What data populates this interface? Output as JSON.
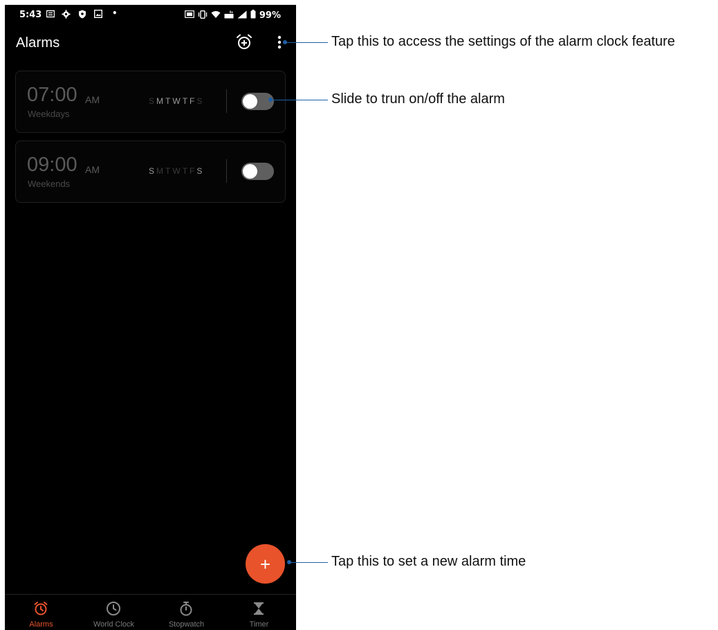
{
  "status_bar": {
    "time": "5:43",
    "battery": "99%"
  },
  "app_bar": {
    "title": "Alarms"
  },
  "alarms": [
    {
      "time": "07:00",
      "ampm": "AM",
      "label": "Weekdays",
      "days": [
        {
          "letter": "S",
          "active": false
        },
        {
          "letter": "M",
          "active": true
        },
        {
          "letter": "T",
          "active": true
        },
        {
          "letter": "W",
          "active": true
        },
        {
          "letter": "T",
          "active": true
        },
        {
          "letter": "F",
          "active": true
        },
        {
          "letter": "S",
          "active": false
        }
      ],
      "enabled": false
    },
    {
      "time": "09:00",
      "ampm": "AM",
      "label": "Weekends",
      "days": [
        {
          "letter": "S",
          "active": true
        },
        {
          "letter": "M",
          "active": false
        },
        {
          "letter": "T",
          "active": false
        },
        {
          "letter": "W",
          "active": false
        },
        {
          "letter": "T",
          "active": false
        },
        {
          "letter": "F",
          "active": false
        },
        {
          "letter": "S",
          "active": true
        }
      ],
      "enabled": false
    }
  ],
  "fab": {
    "icon": "plus-icon",
    "symbol": "+"
  },
  "bottom_nav": [
    {
      "label": "Alarms",
      "icon": "alarm-clock-icon",
      "active": true
    },
    {
      "label": "World Clock",
      "icon": "clock-icon",
      "active": false
    },
    {
      "label": "Stopwatch",
      "icon": "stopwatch-icon",
      "active": false
    },
    {
      "label": "Timer",
      "icon": "hourglass-icon",
      "active": false
    }
  ],
  "annotations": {
    "settings": "Tap this to access the settings of the alarm clock feature",
    "toggle": "Slide to trun on/off the alarm",
    "add": "Tap this to set a new alarm time"
  },
  "colors": {
    "accent": "#e8532b",
    "callout": "#1f5fa6",
    "background": "#000000"
  }
}
